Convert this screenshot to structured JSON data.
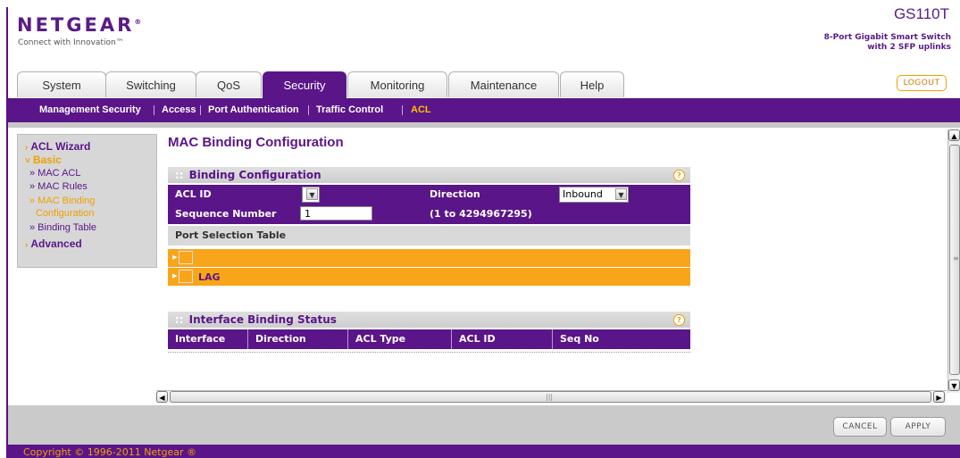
{
  "brand": {
    "logo": "NETGEAR",
    "tagline": "Connect with Innovation™",
    "model": "GS110T",
    "model_desc_1": "8-Port Gigabit Smart Switch",
    "model_desc_2": "with 2 SFP uplinks"
  },
  "tabs": [
    {
      "label": "System"
    },
    {
      "label": "Switching"
    },
    {
      "label": "QoS"
    },
    {
      "label": "Security",
      "active": true
    },
    {
      "label": "Monitoring"
    },
    {
      "label": "Maintenance"
    },
    {
      "label": "Help"
    }
  ],
  "logout_label": "LOGOUT",
  "subnav": [
    {
      "label": "Management Security"
    },
    {
      "label": "Access"
    },
    {
      "label": "Port Authentication"
    },
    {
      "label": "Traffic Control"
    },
    {
      "label": "ACL",
      "active": true
    }
  ],
  "sidebar": {
    "acl_wizard": "ACL Wizard",
    "basic": "Basic",
    "mac_acl": "» MAC ACL",
    "mac_rules": "» MAC Rules",
    "mac_binding_1": "» MAC Binding",
    "mac_binding_2": "Configuration",
    "binding_table": "» Binding Table",
    "advanced": "Advanced"
  },
  "page_title": "MAC Binding Configuration",
  "binding": {
    "header": "Binding Configuration",
    "acl_id_label": "ACL ID",
    "acl_id_value": "",
    "direction_label": "Direction",
    "direction_value": "Inbound",
    "seq_label": "Sequence Number",
    "seq_value": "1",
    "seq_range": "(1 to 4294967295)",
    "port_table_label": "Port Selection Table",
    "row1_label": "",
    "row2_label": "LAG"
  },
  "status": {
    "header": "Interface Binding Status",
    "columns": [
      "Interface",
      "Direction",
      "ACL Type",
      "ACL ID",
      "Seq No"
    ]
  },
  "buttons": {
    "cancel": "CANCEL",
    "apply": "APPLY"
  },
  "copyright": "Copyright © 1996-2011 Netgear ®",
  "colors": {
    "purple": "#5a1589",
    "orange": "#f9a51a"
  }
}
